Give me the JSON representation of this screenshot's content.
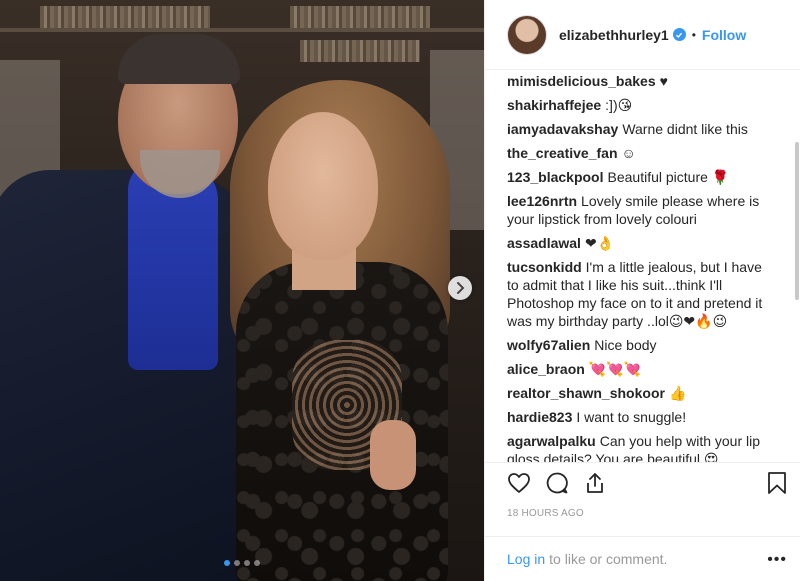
{
  "post": {
    "username": "elizabethhurley1",
    "bullet": "•",
    "follow_label": "Follow",
    "timestamp": "18 HOURS AGO",
    "login_link": "Log in",
    "login_text": "to like or comment.",
    "more_label": "•••"
  },
  "comments": [
    {
      "user": "mimisdelicious_bakes",
      "text": "♥"
    },
    {
      "user": "shakirhaffejee",
      "text": ":])😘"
    },
    {
      "user": "iamyadavakshay",
      "text": "Warne didnt like this"
    },
    {
      "user": "the_creative_fan",
      "text": "☺"
    },
    {
      "user": "123_blackpool",
      "text": "Beautiful picture 🌹"
    },
    {
      "user": "lee126nrtn",
      "text": "Lovely smile please where is your lipstick from lovely colouri"
    },
    {
      "user": "assadlawal",
      "text": "❤👌"
    },
    {
      "user": "tucsonkidd",
      "text": "I'm a little jealous, but I have to admit that I like his suit...think I'll Photoshop my face on to it and pretend it was my birthday party ..lol😉❤🔥😉"
    },
    {
      "user": "wolfy67alien",
      "text": "Nice body"
    },
    {
      "user": "alice_braon",
      "text": "💘💘💘"
    },
    {
      "user": "realtor_shawn_shokoor",
      "text": "👍"
    },
    {
      "user": "hardie823",
      "text": "I want to snuggle!"
    },
    {
      "user": "agarwalpalku",
      "text": "Can you help with your lip gloss details? You are beautiful 😍"
    }
  ],
  "colors": {
    "accent": "#3897f0",
    "text": "#262626",
    "muted": "#999999"
  },
  "icons": {
    "like": "heart-icon",
    "comment": "comment-bubble-icon",
    "share": "share-icon",
    "save": "bookmark-icon",
    "next": "chevron-right-icon"
  },
  "carousel": {
    "total": 4,
    "active": 1
  }
}
